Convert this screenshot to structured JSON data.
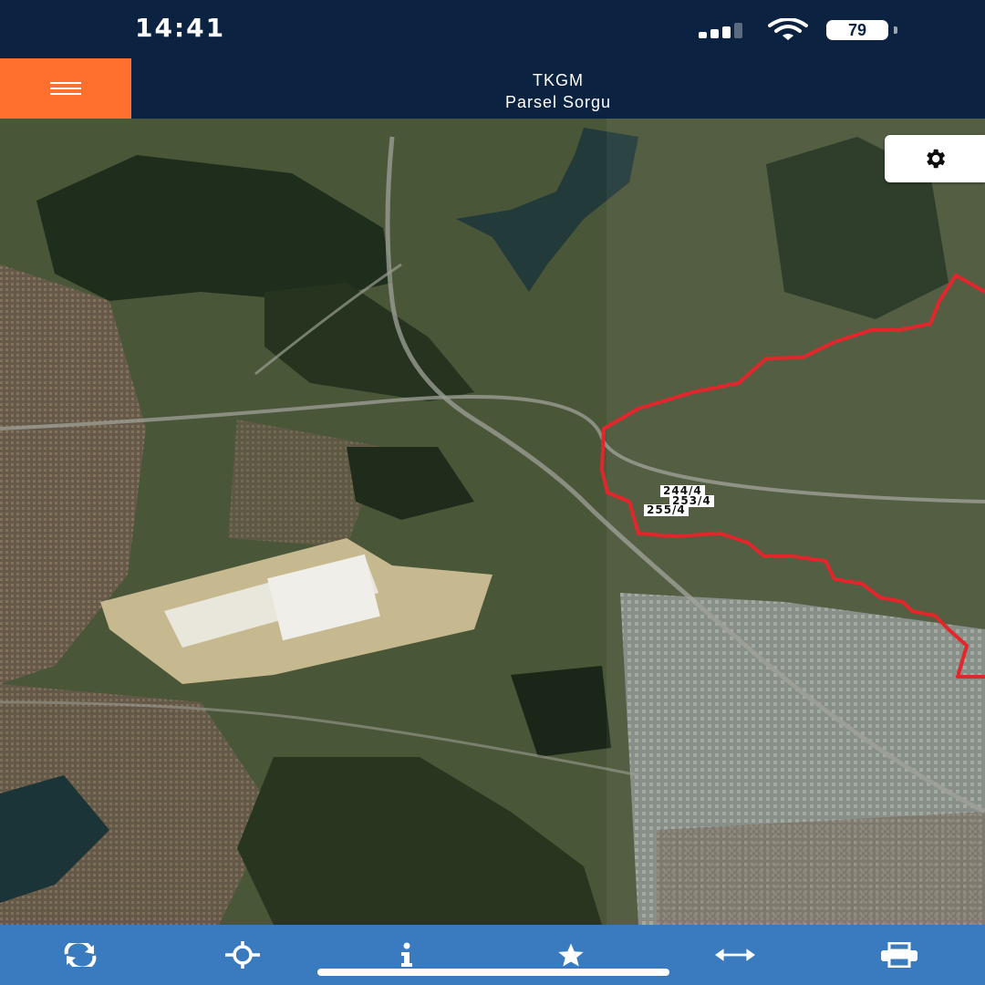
{
  "status_bar": {
    "time": "14:41",
    "battery": "79"
  },
  "header": {
    "title": "TKGM",
    "subtitle": "Parsel Sorgu"
  },
  "map": {
    "parcel_labels": [
      "244/4",
      "253/4",
      "255/4"
    ],
    "boundary_color": "#e3262b"
  },
  "colors": {
    "accent": "#ff6f2e",
    "header_bg": "#0b2240",
    "toolbar_bg": "#3a7bbf"
  },
  "icons": {
    "menu": "hamburger-icon",
    "settings": "gear-icon",
    "toolbar": [
      "refresh-icon",
      "locate-icon",
      "info-icon",
      "star-icon",
      "measure-icon",
      "print-icon"
    ]
  }
}
